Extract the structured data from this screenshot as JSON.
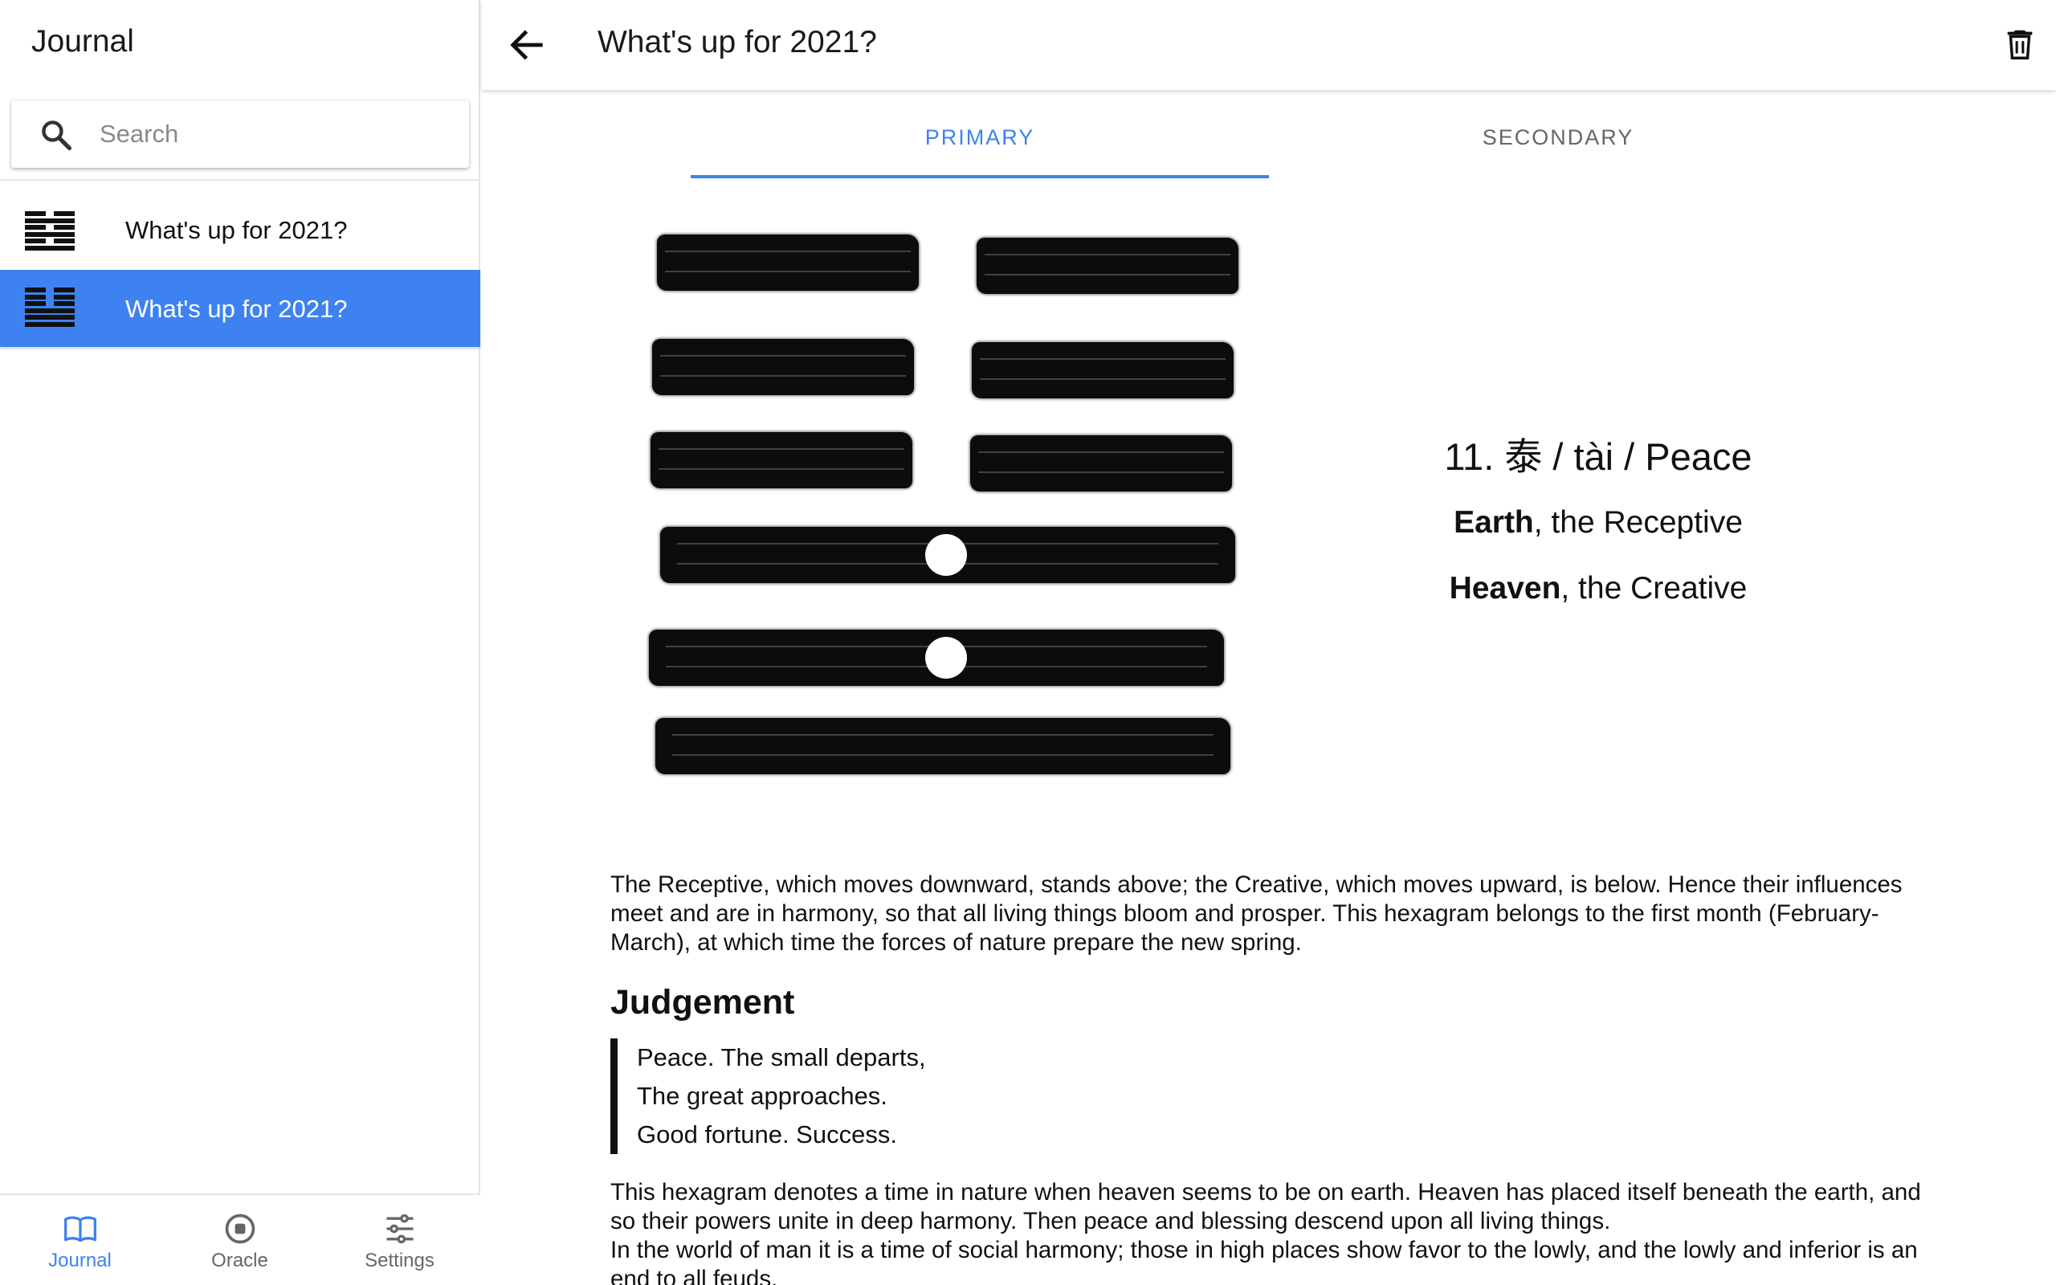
{
  "sidebar": {
    "title": "Journal",
    "search": {
      "placeholder": "Search",
      "value": ""
    },
    "entries": [
      {
        "label": "What's up for 2021?",
        "selected": false,
        "lines": [
          "yin",
          "yang",
          "yin",
          "yang",
          "yin",
          "yang"
        ]
      },
      {
        "label": "What's up for 2021?",
        "selected": true,
        "lines": [
          "yin",
          "yin",
          "yin",
          "yang",
          "yang",
          "yang"
        ]
      }
    ]
  },
  "bottom_nav": {
    "items": [
      {
        "label": "Journal",
        "icon": "book-icon",
        "active": true
      },
      {
        "label": "Oracle",
        "icon": "record-icon",
        "active": false
      },
      {
        "label": "Settings",
        "icon": "sliders-icon",
        "active": false
      }
    ]
  },
  "header": {
    "title": "What's up for 2021?",
    "back_icon": "arrow-left-icon",
    "delete_icon": "trash-icon"
  },
  "tabs": [
    {
      "label": "PRIMARY",
      "active": true
    },
    {
      "label": "SECONDARY",
      "active": false
    }
  ],
  "hexagram": {
    "lines_top_to_bottom": [
      "yin",
      "yin",
      "yin",
      "yang",
      "yang",
      "yang"
    ],
    "moving_lines_top_to_bottom": [
      false,
      false,
      false,
      true,
      true,
      false
    ],
    "name": "11. 泰 / tài / Peace",
    "upper_trigram": {
      "name": "Earth",
      "rest": ", the Receptive"
    },
    "lower_trigram": {
      "name": "Heaven",
      "rest": ", the Creative"
    }
  },
  "reading": {
    "intro": "The Receptive, which moves downward, stands above; the Creative, which moves upward, is below. Hence their influences meet and are in harmony, so that all living things bloom and prosper. This hexagram belongs to the first month (February-March), at which time the forces of nature prepare the new spring.",
    "judgement_heading": "Judgement",
    "judgement_lines": [
      "Peace. The small departs,",
      "The great approaches.",
      "Good fortune. Success."
    ],
    "commentary_1": "This hexagram denotes a time in nature when heaven seems to be on earth. Heaven has placed itself beneath the earth, and so their powers unite in deep harmony. Then peace and blessing descend upon all living things.",
    "commentary_2": "In the world of man it is a time of social harmony; those in high places show favor to the lowly, and the lowly and inferior is an end to all feuds."
  },
  "colors": {
    "accent": "#3d82f0",
    "selected_row": "#3d82f0",
    "ink": "#0c0c0c"
  }
}
